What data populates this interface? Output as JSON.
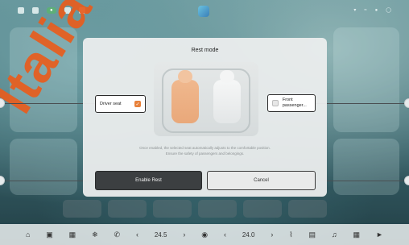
{
  "dialog": {
    "title": "Rest mode",
    "driver_seat_label": "Driver seat",
    "front_passenger_label": "Front passenger...",
    "description_line1": "Once enabled, the selected seat automatically adjusts to the comfortable position.",
    "description_line2": "Ensure the safety of passengers and belongings.",
    "enable_button": "Enable Rest",
    "cancel_button": "Cancel"
  },
  "dock": {
    "left_temp": "24.5",
    "right_temp": "24.0"
  },
  "watermark": "Italia",
  "colors": {
    "accent": "#e8813a",
    "watermark": "#e85c1c"
  }
}
